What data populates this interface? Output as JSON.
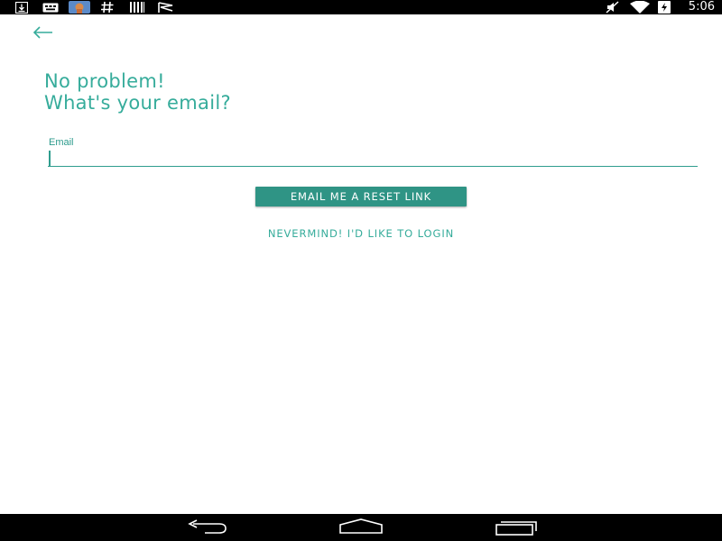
{
  "status_bar": {
    "time": "5:06",
    "left_icons": [
      "download-icon",
      "keyboard-icon",
      "app-thumbnail-icon",
      "hashtag-icon",
      "barcode-icon",
      "flag-icon"
    ],
    "right_icons": [
      "mute-icon",
      "wifi-icon",
      "battery-charging-icon"
    ]
  },
  "header": {
    "back_icon": "arrow-left-icon",
    "title_line1": "No problem!",
    "title_line2": "What's your email?"
  },
  "form": {
    "email_label": "Email",
    "email_value": "",
    "reset_button_label": "EMAIL ME A RESET LINK",
    "login_link_label": "NEVERMIND! I'D LIKE TO LOGIN"
  },
  "nav_bar": {
    "buttons": [
      "back-nav-icon",
      "home-nav-icon",
      "recent-apps-nav-icon"
    ]
  },
  "colors": {
    "accent": "#36ac9b",
    "button_bg": "#2f9485",
    "background": "#ffffff",
    "bars": "#000000"
  }
}
